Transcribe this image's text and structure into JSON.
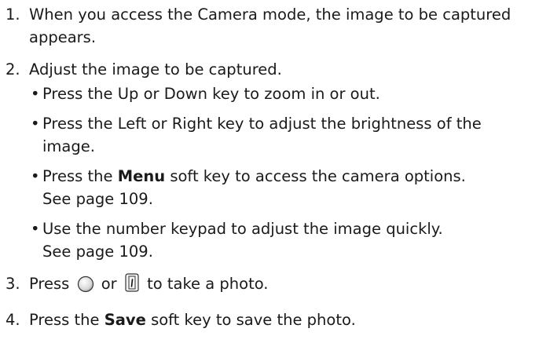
{
  "steps": [
    {
      "number": "1.",
      "text": "When you access the Camera mode, the image to be captured appears."
    },
    {
      "number": "2.",
      "text": "Adjust the image to be captured.",
      "bullets": [
        {
          "text": "Press the Up or Down key to zoom in or out."
        },
        {
          "text": "Press the Left or Right key to adjust the brightness of the image."
        },
        {
          "pre": "Press the ",
          "bold": "Menu",
          "post": " soft key to access the camera options.",
          "ref": "See page 109."
        },
        {
          "text": "Use the number keypad to adjust the image quickly.",
          "ref": "See page 109."
        }
      ]
    },
    {
      "number": "3.",
      "pre": "Press",
      "mid": "or",
      "post": "to take a photo.",
      "icons": [
        "round-button-icon",
        "camera-key-icon"
      ]
    },
    {
      "number": "4.",
      "pre": "Press the ",
      "bold": "Save",
      "post": " soft key to save the photo."
    }
  ]
}
